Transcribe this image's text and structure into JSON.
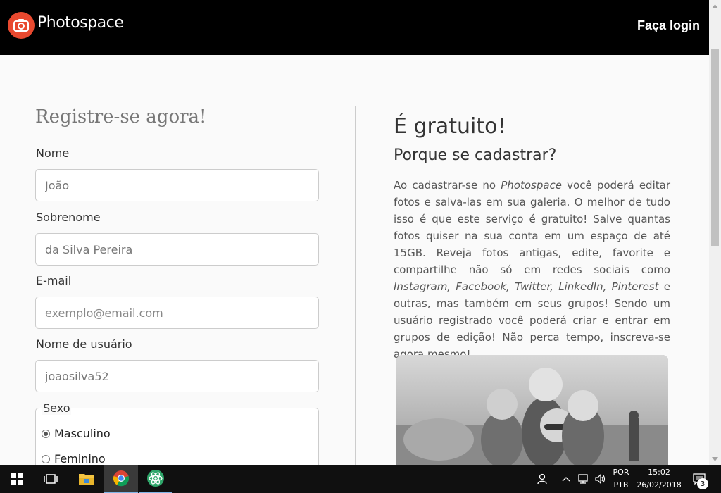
{
  "header": {
    "brand": "Photospace",
    "login_label": "Faça login"
  },
  "form": {
    "title": "Registre-se agora!",
    "fields": [
      {
        "label": "Nome",
        "value": "João",
        "placeholder": ""
      },
      {
        "label": "Sobrenome",
        "value": "da Silva Pereira",
        "placeholder": ""
      },
      {
        "label": "E-mail",
        "value": "",
        "placeholder": "exemplo@email.com"
      },
      {
        "label": "Nome de usuário",
        "value": "joaosilva52",
        "placeholder": ""
      }
    ],
    "sex": {
      "legend": "Sexo",
      "options": [
        {
          "label": "Masculino",
          "checked": true
        },
        {
          "label": "Feminino",
          "checked": false
        }
      ]
    }
  },
  "info": {
    "title": "É gratuito!",
    "subtitle": "Porque se cadastrar?",
    "p1": "Ao cadastrar-se no ",
    "brand": "Photospace",
    "p2": " você poderá editar fotos e salva-las em sua galeria. O melhor de tudo isso é que este serviço é gratuito! Salve quantas fotos quiser na sua conta em um espaço de até 15GB. Reveja fotos antigas, edite, favorite e compartilhe não só em redes sociais como ",
    "socials": "Instagram, Facebook, Twitter, LinkedIn, Pinterest",
    "p3": " e outras, mas também em seus grupos! Sendo um usuário registrado você poderá criar e entrar em grupos de edição! Não perca tempo, inscreva-se agora mesmo!"
  },
  "taskbar": {
    "language_top": "POR",
    "language_bottom": "PTB",
    "time": "15:02",
    "date": "26/02/2018",
    "notification_count": "3"
  },
  "colors": {
    "brand": "#e8492f",
    "header_bg": "#000000",
    "page_bg": "#fafafa"
  }
}
